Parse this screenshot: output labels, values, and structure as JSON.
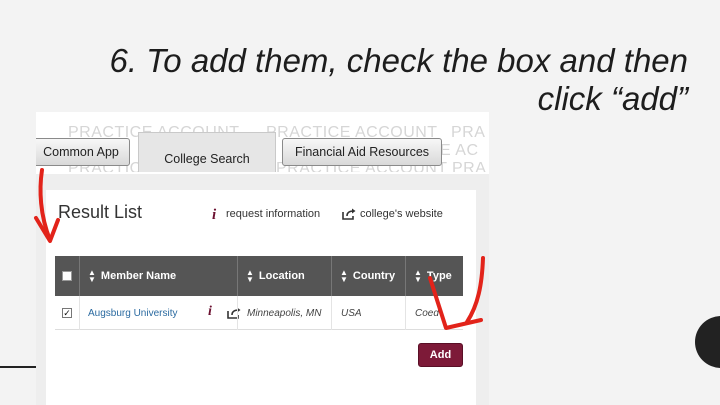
{
  "slide": {
    "title": "6. To add them, check the box and then click “add”"
  },
  "navbar": {
    "watermark": "PRACTICE ACCOUNT",
    "watermark_partial": "PRA",
    "watermark_partial_2": "CE AC",
    "common_app": "Common App",
    "college_search": "College Search",
    "financial_aid": "Financial Aid Resources"
  },
  "result_list": {
    "title": "Result List",
    "request_info_icon": "i",
    "request_info_label": "request information",
    "website_label": "college's website",
    "columns": [
      "Member Name",
      "Location",
      "Country",
      "Type"
    ],
    "rows": [
      {
        "checked": true,
        "check_mark": "✓",
        "name": "Augsburg University",
        "info_icon": "i",
        "location": "Minneapolis, MN",
        "country": "USA",
        "type": "Coed"
      }
    ],
    "add_button": "Add"
  },
  "annotations": {
    "arrow_color": "#e2231a",
    "arrows": [
      "red-arrow-to-checkbox",
      "red-arrow-to-add-button"
    ]
  },
  "colors": {
    "accent": "#7d1a38",
    "header_gray": "#555555",
    "link_blue": "#2a6aa0"
  }
}
